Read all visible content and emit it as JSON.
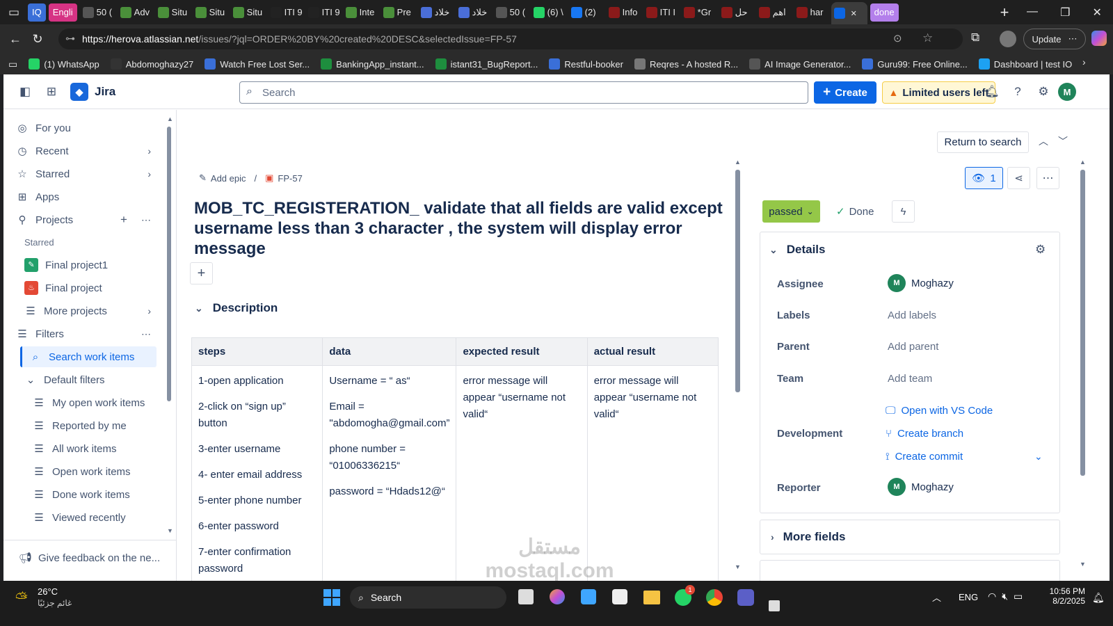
{
  "browser": {
    "tabs": [
      {
        "label": "IQ",
        "pill": true,
        "bg": "#3a6fd8"
      },
      {
        "label": "Engli",
        "pill": true,
        "bg": "#d63384"
      },
      {
        "label": "50 (",
        "icon": "#555"
      },
      {
        "label": "Adv",
        "icon": "#4a8f3a"
      },
      {
        "label": "Situ",
        "icon": "#4a8f3a"
      },
      {
        "label": "Situ",
        "icon": "#4a8f3a"
      },
      {
        "label": "Situ",
        "icon": "#4a8f3a"
      },
      {
        "label": "ITI 9",
        "icon": "#222"
      },
      {
        "label": "ITI 9",
        "icon": "#222"
      },
      {
        "label": "Inte",
        "icon": "#4a8f3a"
      },
      {
        "label": "Pre",
        "icon": "#4a8f3a"
      },
      {
        "label": "خلاد",
        "icon": "#4a6ed8"
      },
      {
        "label": "خلاد",
        "icon": "#4a6ed8"
      },
      {
        "label": "50 (",
        "icon": "#555"
      },
      {
        "label": "(6) \\",
        "icon": "#25d366"
      },
      {
        "label": "(2)",
        "icon": "#1877f2"
      },
      {
        "label": "Info",
        "icon": "#8b1a1a"
      },
      {
        "label": "ITI I",
        "icon": "#8b1a1a"
      },
      {
        "label": "*Gr",
        "icon": "#8b1a1a"
      },
      {
        "label": "حل",
        "icon": "#8b1a1a"
      },
      {
        "label": "اهم",
        "icon": "#8b1a1a"
      },
      {
        "label": "har",
        "icon": "#8b1a1a"
      },
      {
        "label": "",
        "icon": "#0c66e4",
        "active": true,
        "close": "✕"
      },
      {
        "label": "done",
        "pill": true,
        "bg": "#b37feb"
      }
    ],
    "new_tab": "+",
    "url_domain": "https://herova.atlassian.net",
    "url_path": "/issues/?jql=ORDER%20BY%20created%20DESC&selectedIssue=FP-57",
    "update_label": "Update",
    "bookmarks": [
      {
        "label": "(1) WhatsApp",
        "color": "#25d366"
      },
      {
        "label": "Abdomoghazy27",
        "color": "#333"
      },
      {
        "label": "Watch Free Lost Ser...",
        "color": "#3a6fd8"
      },
      {
        "label": "BankingApp_instant...",
        "color": "#1e8e3e"
      },
      {
        "label": "istant31_BugReport...",
        "color": "#1e8e3e"
      },
      {
        "label": "Restful-booker",
        "color": "#3a6fd8"
      },
      {
        "label": "Reqres - A hosted R...",
        "color": "#777"
      },
      {
        "label": "AI Image Generator...",
        "color": "#555"
      },
      {
        "label": "Guru99: Free Online...",
        "color": "#3a6fd8"
      },
      {
        "label": "Dashboard | test IO",
        "color": "#1da1f2"
      }
    ]
  },
  "jira": {
    "app_name": "Jira",
    "search_placeholder": "Search",
    "create_label": "Create",
    "limited_label": "Limited users left",
    "user_initial": "M"
  },
  "sidebar": {
    "for_you": "For you",
    "recent": "Recent",
    "starred": "Starred",
    "apps": "Apps",
    "projects": "Projects",
    "starred_header": "Starred",
    "project1": "Final project1",
    "project2": "Final project",
    "more_projects": "More projects",
    "filters": "Filters",
    "search_work_items": "Search work items",
    "default_filters": "Default filters",
    "filter_items": [
      "My open work items",
      "Reported by me",
      "All work items",
      "Open work items",
      "Done work items",
      "Viewed recently"
    ],
    "feedback": "Give feedback on the ne..."
  },
  "issue": {
    "return_to_search": "Return to search",
    "add_epic": "Add epic",
    "key": "FP-57",
    "title": "MOB_TC_REGISTERATION_ validate that all fields are valid except username less than 3 character , the system will display error message",
    "description_heading": "Description",
    "watchers": "1",
    "status": "passed",
    "resolution": "Done",
    "table": {
      "headers": [
        "steps",
        "data",
        "expected result",
        "actual result"
      ],
      "steps": [
        "1-open application",
        "2-click on “sign up” button",
        "3-enter username",
        "4- enter email address",
        "5-enter phone number",
        "6-enter password",
        "7-enter confirmation password"
      ],
      "data": [
        "Username = “ as“",
        "Email = \"abdomogha@gmail.com”",
        "phone number = “01006336215“",
        "password = “Hdads12@“"
      ],
      "expected": "error message will appear “username not valid“",
      "actual": "error message will appear “username not valid“"
    }
  },
  "details": {
    "heading": "Details",
    "assignee_label": "Assignee",
    "assignee": "Moghazy",
    "labels_label": "Labels",
    "labels_value": "Add labels",
    "parent_label": "Parent",
    "parent_value": "Add parent",
    "team_label": "Team",
    "team_value": "Add team",
    "development_label": "Development",
    "open_vs_code": "Open with VS Code",
    "create_branch": "Create branch",
    "create_commit": "Create commit",
    "reporter_label": "Reporter",
    "reporter": "Moghazy",
    "avatar_initial": "M",
    "more_fields": "More fields"
  },
  "taskbar": {
    "temp": "26°C",
    "weather": "غائم جزئيًا",
    "search": "Search",
    "lang": "ENG",
    "time": "10:56 PM",
    "date": "8/2/2025",
    "badge": "1"
  },
  "watermark": "مستقل mostaql.com",
  "colors": {
    "accent": "#0c66e4",
    "status": "#94c748",
    "selected": "#e9f2ff"
  }
}
